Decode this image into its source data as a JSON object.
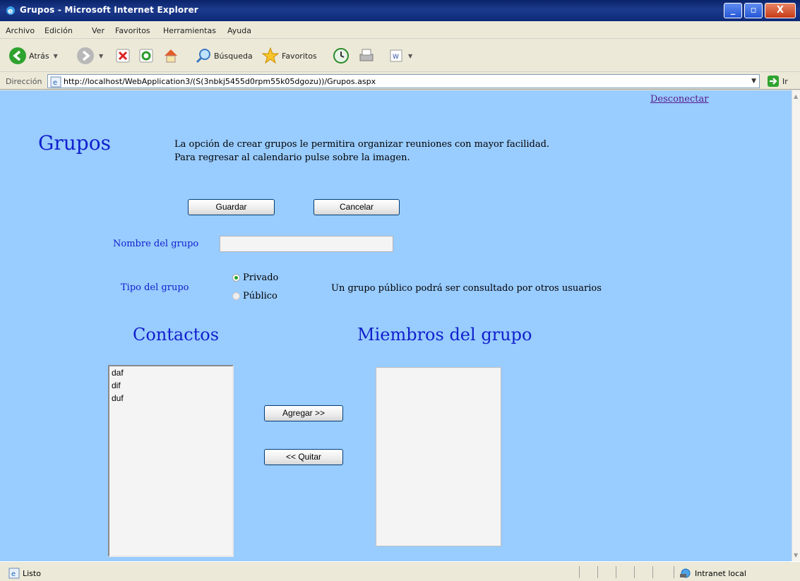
{
  "window": {
    "title": "Grupos - Microsoft Internet Explorer",
    "controls": {
      "minimize": "_",
      "maximize": "▫",
      "close": "X"
    }
  },
  "menu": [
    "Archivo",
    "Edición",
    "Ver",
    "Favoritos",
    "Herramientas",
    "Ayuda"
  ],
  "toolbar": {
    "back": "Atrás",
    "search": "Búsqueda",
    "favorites": "Favoritos"
  },
  "address": {
    "label": "Dirección",
    "url": "http://localhost/WebApplication3/(S(3nbkj5455d0rpm55k05dgozu))/Grupos.aspx",
    "go": "Ir"
  },
  "page": {
    "logout_link": "Desconectar",
    "title": "Grupos",
    "intro_line1": "La opción de crear grupos le permitira organizar reuniones con mayor facilidad.",
    "intro_line2": "Para regresar al calendario pulse sobre la imagen.",
    "save_button": "Guardar",
    "cancel_button": "Cancelar",
    "group_name_label": "Nombre del grupo",
    "group_name_value": "",
    "group_type_label": "Tipo del grupo",
    "type_options": [
      {
        "label": "Privado",
        "selected": true
      },
      {
        "label": "Público",
        "selected": false
      }
    ],
    "public_note": "Un grupo público podrá ser consultado por otros usuarios",
    "contacts_heading": "Contactos",
    "members_heading": "Miembros del grupo",
    "contacts": [
      "daf",
      "dif",
      "duf"
    ],
    "members": [],
    "add_button": "Agregar >>",
    "remove_button": "<< Quitar"
  },
  "status": {
    "text": "Listo",
    "zone": "Intranet local"
  },
  "colors": {
    "page_background": "#99ccff",
    "heading_blue": "#1020cc",
    "visited_link": "#551a8b"
  }
}
